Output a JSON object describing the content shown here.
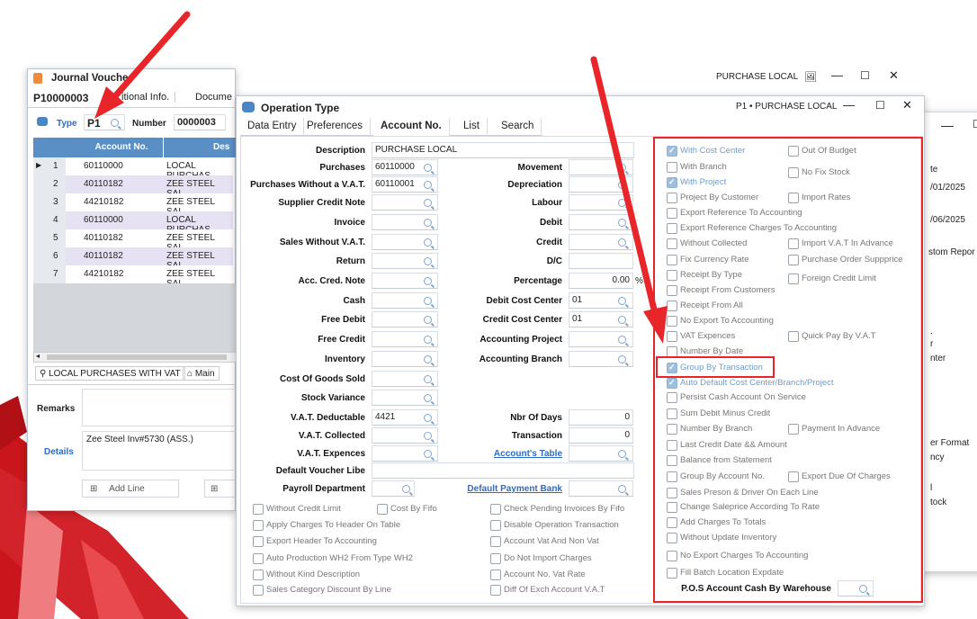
{
  "journal": {
    "title": "Journal Vouche",
    "voucher_id": "P10000003",
    "tabs": [
      "itional Info.",
      "Docume"
    ],
    "type_label": "Type",
    "type_value": "P1",
    "number_label": "Number",
    "number_value": "0000003",
    "grid_headers": [
      "Account No.",
      "Des"
    ],
    "rows": [
      {
        "n": "1",
        "acc": "60110000",
        "desc": "LOCAL PURCHAS"
      },
      {
        "n": "2",
        "acc": "40110182",
        "desc": "ZEE STEEL SAL"
      },
      {
        "n": "3",
        "acc": "44210182",
        "desc": "ZEE STEEL SAL"
      },
      {
        "n": "4",
        "acc": "60110000",
        "desc": "LOCAL PURCHAS"
      },
      {
        "n": "5",
        "acc": "40110182",
        "desc": "ZEE STEEL SAL"
      },
      {
        "n": "6",
        "acc": "40110182",
        "desc": "ZEE STEEL SAL"
      },
      {
        "n": "7",
        "acc": "44210182",
        "desc": "ZEE STEEL SAL"
      }
    ],
    "footer_account": "LOCAL PURCHASES WITH VAT",
    "footer_main": "Main",
    "remarks_label": "Remarks",
    "details_label": "Details",
    "details_value": "Zee Steel Inv#5730 (ASS.)",
    "add_line": "Add Line"
  },
  "top_bar": {
    "title": "PURCHASE LOCAL"
  },
  "back_window": {
    "texts": [
      "te",
      "/01/2025",
      "/06/2025",
      "stom Repor",
      ".",
      "r",
      "nter",
      "er Format",
      "ncy",
      "l",
      "tock"
    ]
  },
  "op": {
    "title": "Operation Type",
    "subtitle": "P1 • PURCHASE LOCAL",
    "tabs": [
      "Data Entry",
      "Preferences",
      "Account No.",
      "List",
      "Search"
    ],
    "description_label": "Description",
    "description_value": "PURCHASE LOCAL",
    "left_labels": [
      "Purchases",
      "Purchases Without a V.A.T.",
      "Supplier Credit Note",
      "Invoice",
      "Sales Without V.A.T.",
      "Return",
      "Acc. Cred. Note",
      "Cash",
      "Free Debit",
      "Free Credit",
      "Inventory",
      "Cost Of Goods Sold",
      "Stock Variance",
      "V.A.T. Deductable",
      "V.A.T. Collected",
      "V.A.T. Expences",
      "Default Voucher Libe",
      "Payroll Department"
    ],
    "left_values": [
      "60110000",
      "60110001",
      "",
      "",
      "",
      "",
      "",
      "",
      "",
      "",
      "",
      "",
      "",
      "4421",
      "",
      "",
      "",
      ""
    ],
    "mid_labels": [
      "Movement",
      "Depreciation",
      "Labour",
      "Debit",
      "Credit",
      "D/C",
      "Percentage",
      "Debit Cost Center",
      "Credit Cost Center",
      "Accounting Project",
      "Accounting Branch"
    ],
    "mid_values": [
      "",
      "",
      "",
      "",
      "",
      "",
      "0.00",
      "01",
      "01",
      "",
      ""
    ],
    "percent_sign": "%",
    "nbr_days_label": "Nbr Of Days",
    "nbr_days_value": "0",
    "transaction_label": "Transaction",
    "transaction_value": "0",
    "accounts_table_link": "Account's Table",
    "default_payment_bank_link": "Default Payment Bank",
    "bottom_left_checks": [
      "Without Credit Limit",
      "Apply Charges To Header On Table",
      "Export Header To Accounting",
      "Auto Production WH2 From Type WH2",
      "Without Kind Description",
      "Sales Category Discount By Line"
    ],
    "cost_by_fifo": "Cost By Fifo",
    "bottom_mid_checks": [
      "Check Pending Invoices By Fifo",
      "Disable Operation Transaction",
      "Account Vat And Non Vat",
      "Do Not Import Charges",
      "Account No. Vat Rate",
      "Diff Of Exch Account V.A.T"
    ],
    "right_checks": [
      "With Cost Center",
      "With Branch",
      "With Project",
      "Project By Customer",
      "Export Reference To Accounting",
      "Export Reference Charges To Accounting",
      "Without Collected",
      "Fix Currency Rate",
      "Receipt By Type",
      "Receipt From Customers",
      "Receipt From All",
      "No Export To Accounting",
      "VAT Expences",
      "Number By Date",
      "Group By Transaction",
      "Auto Default Cost Center/Branch/Project",
      "Persist Cash Account On Service",
      "Sum Debit Minus Credit",
      "Number By Branch",
      "Last Credit Date && Amount",
      "Balance from Statement",
      "Group By Account No.",
      "Sales Preson & Driver On Each Line",
      "Change Saleprice According To Rate",
      "Add Charges To Totals",
      "Without Update Inventory",
      "No Export Charges To Accounting",
      "Fill Batch Location Expdate"
    ],
    "right2_checks": [
      "Out Of Budget",
      "No Fix Stock",
      "Import Rates",
      "Import V.A.T In Advance",
      "Purchase Order Suppprice",
      "Foreign Credit Limit",
      "Quick Pay By V.A.T",
      "Payment In Advance",
      "Export Due Of Charges"
    ],
    "pos_label": "P.O.S Account Cash By Warehouse"
  },
  "colors": {
    "accent": "#2f6bbf",
    "arrow": "#e8262a",
    "highlight": "#e8262a",
    "grid_header": "#5a8fc6"
  }
}
